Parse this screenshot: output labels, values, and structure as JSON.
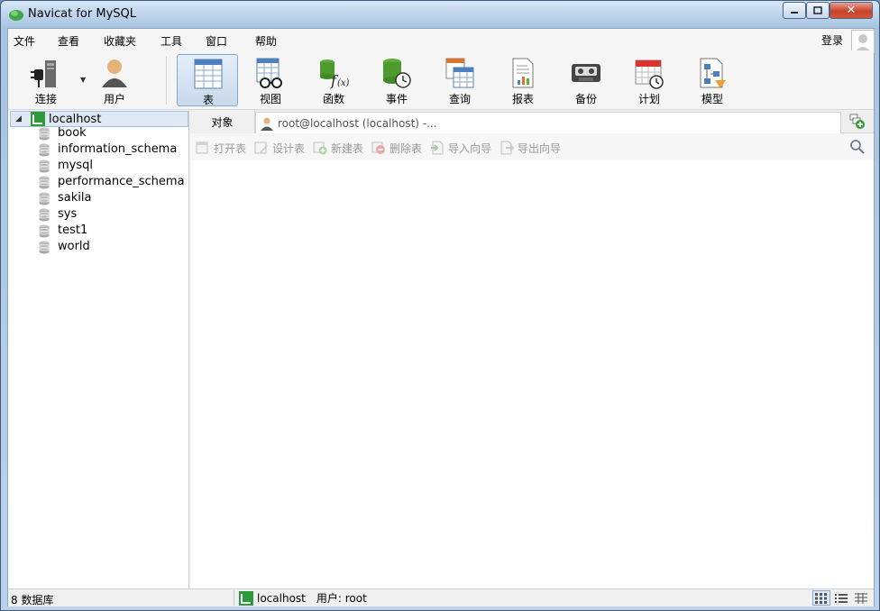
{
  "window": {
    "title": "Navicat for MySQL"
  },
  "menu": {
    "items": [
      "文件",
      "查看",
      "收藏夹",
      "工具",
      "窗口",
      "帮助"
    ],
    "login": "登录"
  },
  "toolbar": {
    "connect": "连接",
    "user": "用户",
    "table": "表",
    "view": "视图",
    "function": "函数",
    "event": "事件",
    "query": "查询",
    "report": "报表",
    "backup": "备份",
    "schedule": "计划",
    "model": "模型"
  },
  "tree": {
    "root": "localhost",
    "databases": [
      "book",
      "information_schema",
      "mysql",
      "performance_schema",
      "sakila",
      "sys",
      "test1",
      "world"
    ]
  },
  "tabs": {
    "objects": "对象",
    "connection": "root@localhost (localhost) -..."
  },
  "objbar": {
    "open_table": "打开表",
    "design_table": "设计表",
    "new_table": "新建表",
    "delete_table": "删除表",
    "import_wizard": "导入向导",
    "export_wizard": "导出向导"
  },
  "status": {
    "db_count": "8 数据库",
    "host": "localhost",
    "user": "用户: root"
  },
  "colors": {
    "accent_green": "#2e9a3a",
    "selection": "#dfe9f5",
    "close_red": "#c7422a"
  }
}
